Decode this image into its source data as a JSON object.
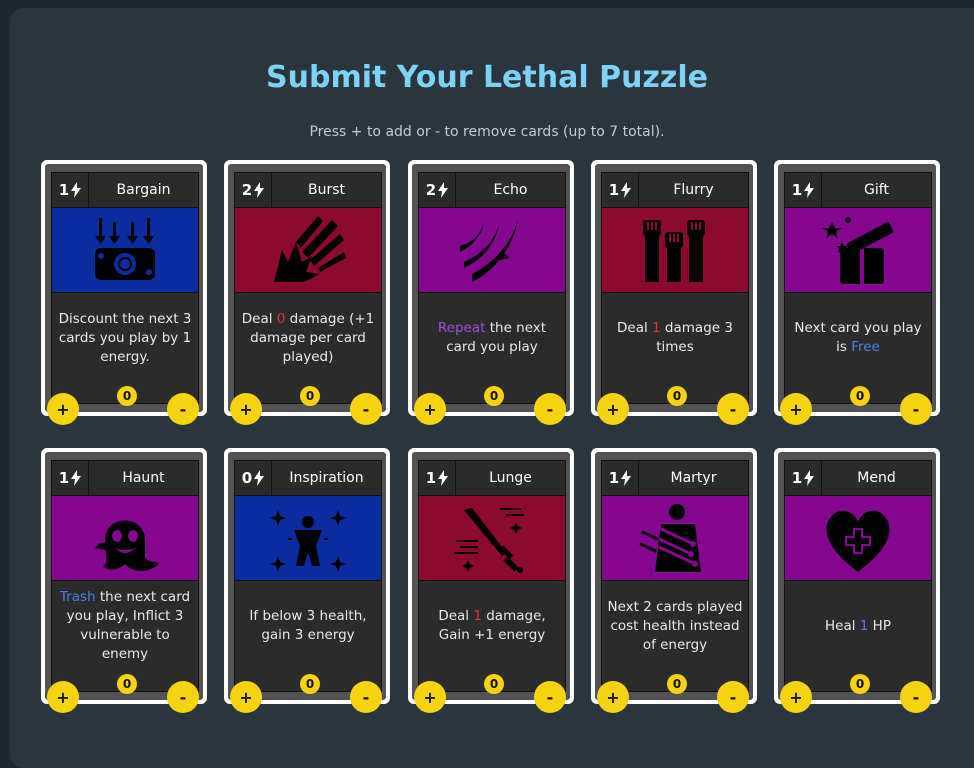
{
  "header": {
    "title": "Submit Your Lethal Puzzle",
    "subtitle": "Press + to add or - to remove cards (up to 7 total)."
  },
  "colors": {
    "blue": "#0a2c9e",
    "red": "#8c0a2e",
    "purple": "#86078f",
    "title": "#7dd3f7",
    "button": "#f7d20f"
  },
  "buttons": {
    "plus": "+",
    "minus": "-"
  },
  "cards": [
    {
      "cost": "1",
      "name": "Bargain",
      "art_color": "#0a2c9e",
      "icon": "discount-bill-icon",
      "desc_pre": "Discount the next 3 cards you play by 1 energy.",
      "desc_hl": "",
      "desc_post": "",
      "count": "0"
    },
    {
      "cost": "2",
      "name": "Burst",
      "art_color": "#8c0a2e",
      "icon": "burst-icon",
      "desc_pre": "Deal ",
      "desc_hl": "0",
      "desc_post": " damage (+1 damage per card played)",
      "count": "0"
    },
    {
      "cost": "2",
      "name": "Echo",
      "art_color": "#86078f",
      "icon": "echo-slash-icon",
      "desc_pre": "",
      "desc_hl": "Repeat",
      "desc_post": " the next card you play",
      "count": "0"
    },
    {
      "cost": "1",
      "name": "Flurry",
      "art_color": "#8c0a2e",
      "icon": "fists-icon",
      "desc_pre": "Deal ",
      "desc_hl": "1",
      "desc_post": " damage 3 times",
      "count": "0"
    },
    {
      "cost": "1",
      "name": "Gift",
      "art_color": "#86078f",
      "icon": "gift-icon",
      "desc_pre": "Next card you play is ",
      "desc_hl": "Free",
      "desc_post": "",
      "count": "0"
    },
    {
      "cost": "1",
      "name": "Haunt",
      "art_color": "#86078f",
      "icon": "ghost-icon",
      "desc_pre": "",
      "desc_hl": "Trash",
      "desc_post": " the next card you play, Inflict 3 vulnerable to enemy",
      "count": "0"
    },
    {
      "cost": "0",
      "name": "Inspiration",
      "art_color": "#0a2c9e",
      "icon": "sparkle-figure-icon",
      "desc_pre": "If below 3 health, gain 3 energy",
      "desc_hl": "",
      "desc_post": "",
      "count": "0"
    },
    {
      "cost": "1",
      "name": "Lunge",
      "art_color": "#8c0a2e",
      "icon": "sword-lunge-icon",
      "desc_pre": "Deal ",
      "desc_hl": "1",
      "desc_post": " damage, Gain +1 energy",
      "count": "0"
    },
    {
      "cost": "1",
      "name": "Martyr",
      "art_color": "#86078f",
      "icon": "martyr-icon",
      "desc_pre": "Next 2 cards played cost health instead of energy",
      "desc_hl": "",
      "desc_post": "",
      "count": "0"
    },
    {
      "cost": "1",
      "name": "Mend",
      "art_color": "#86078f",
      "icon": "heart-cross-icon",
      "desc_pre": "Heal ",
      "desc_hl": "1",
      "desc_post": " HP",
      "count": "0"
    }
  ]
}
